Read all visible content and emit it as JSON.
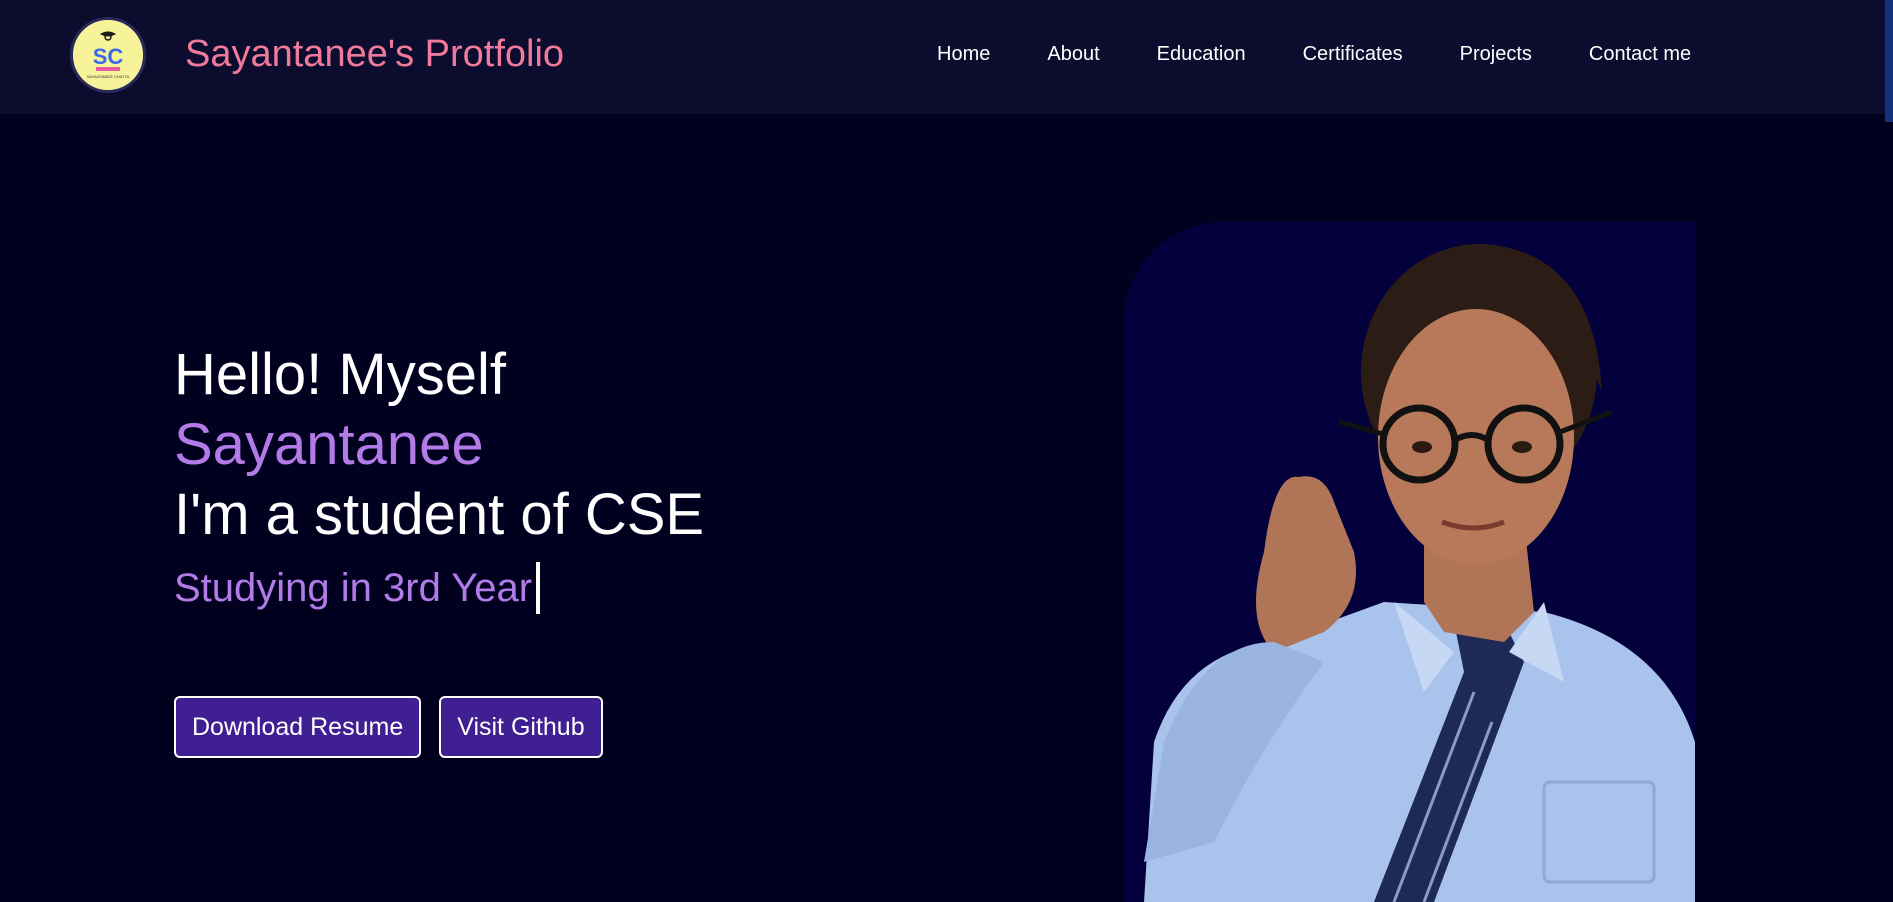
{
  "header": {
    "brand": "Sayantanee's Protfolio",
    "logo": {
      "initials": "SC",
      "caption": "SAYANTANEE CHATTA"
    },
    "nav": [
      "Home",
      "About",
      "Education",
      "Certificates",
      "Projects",
      "Contact me"
    ]
  },
  "hero": {
    "greeting": "Hello! Myself",
    "name": "Sayantanee",
    "tagline": "I'm a student of CSE",
    "typed_text": "Studying in 3rd Year",
    "buttons": {
      "resume": "Download Resume",
      "github": "Visit Github"
    }
  },
  "colors": {
    "page_bg": "#02001f",
    "navbar_bg": "#0c0c2e",
    "brand": "#f07a9c",
    "accent": "#b27be8",
    "button_bg": "#3f1f91",
    "photo_bg": "#03003c"
  }
}
